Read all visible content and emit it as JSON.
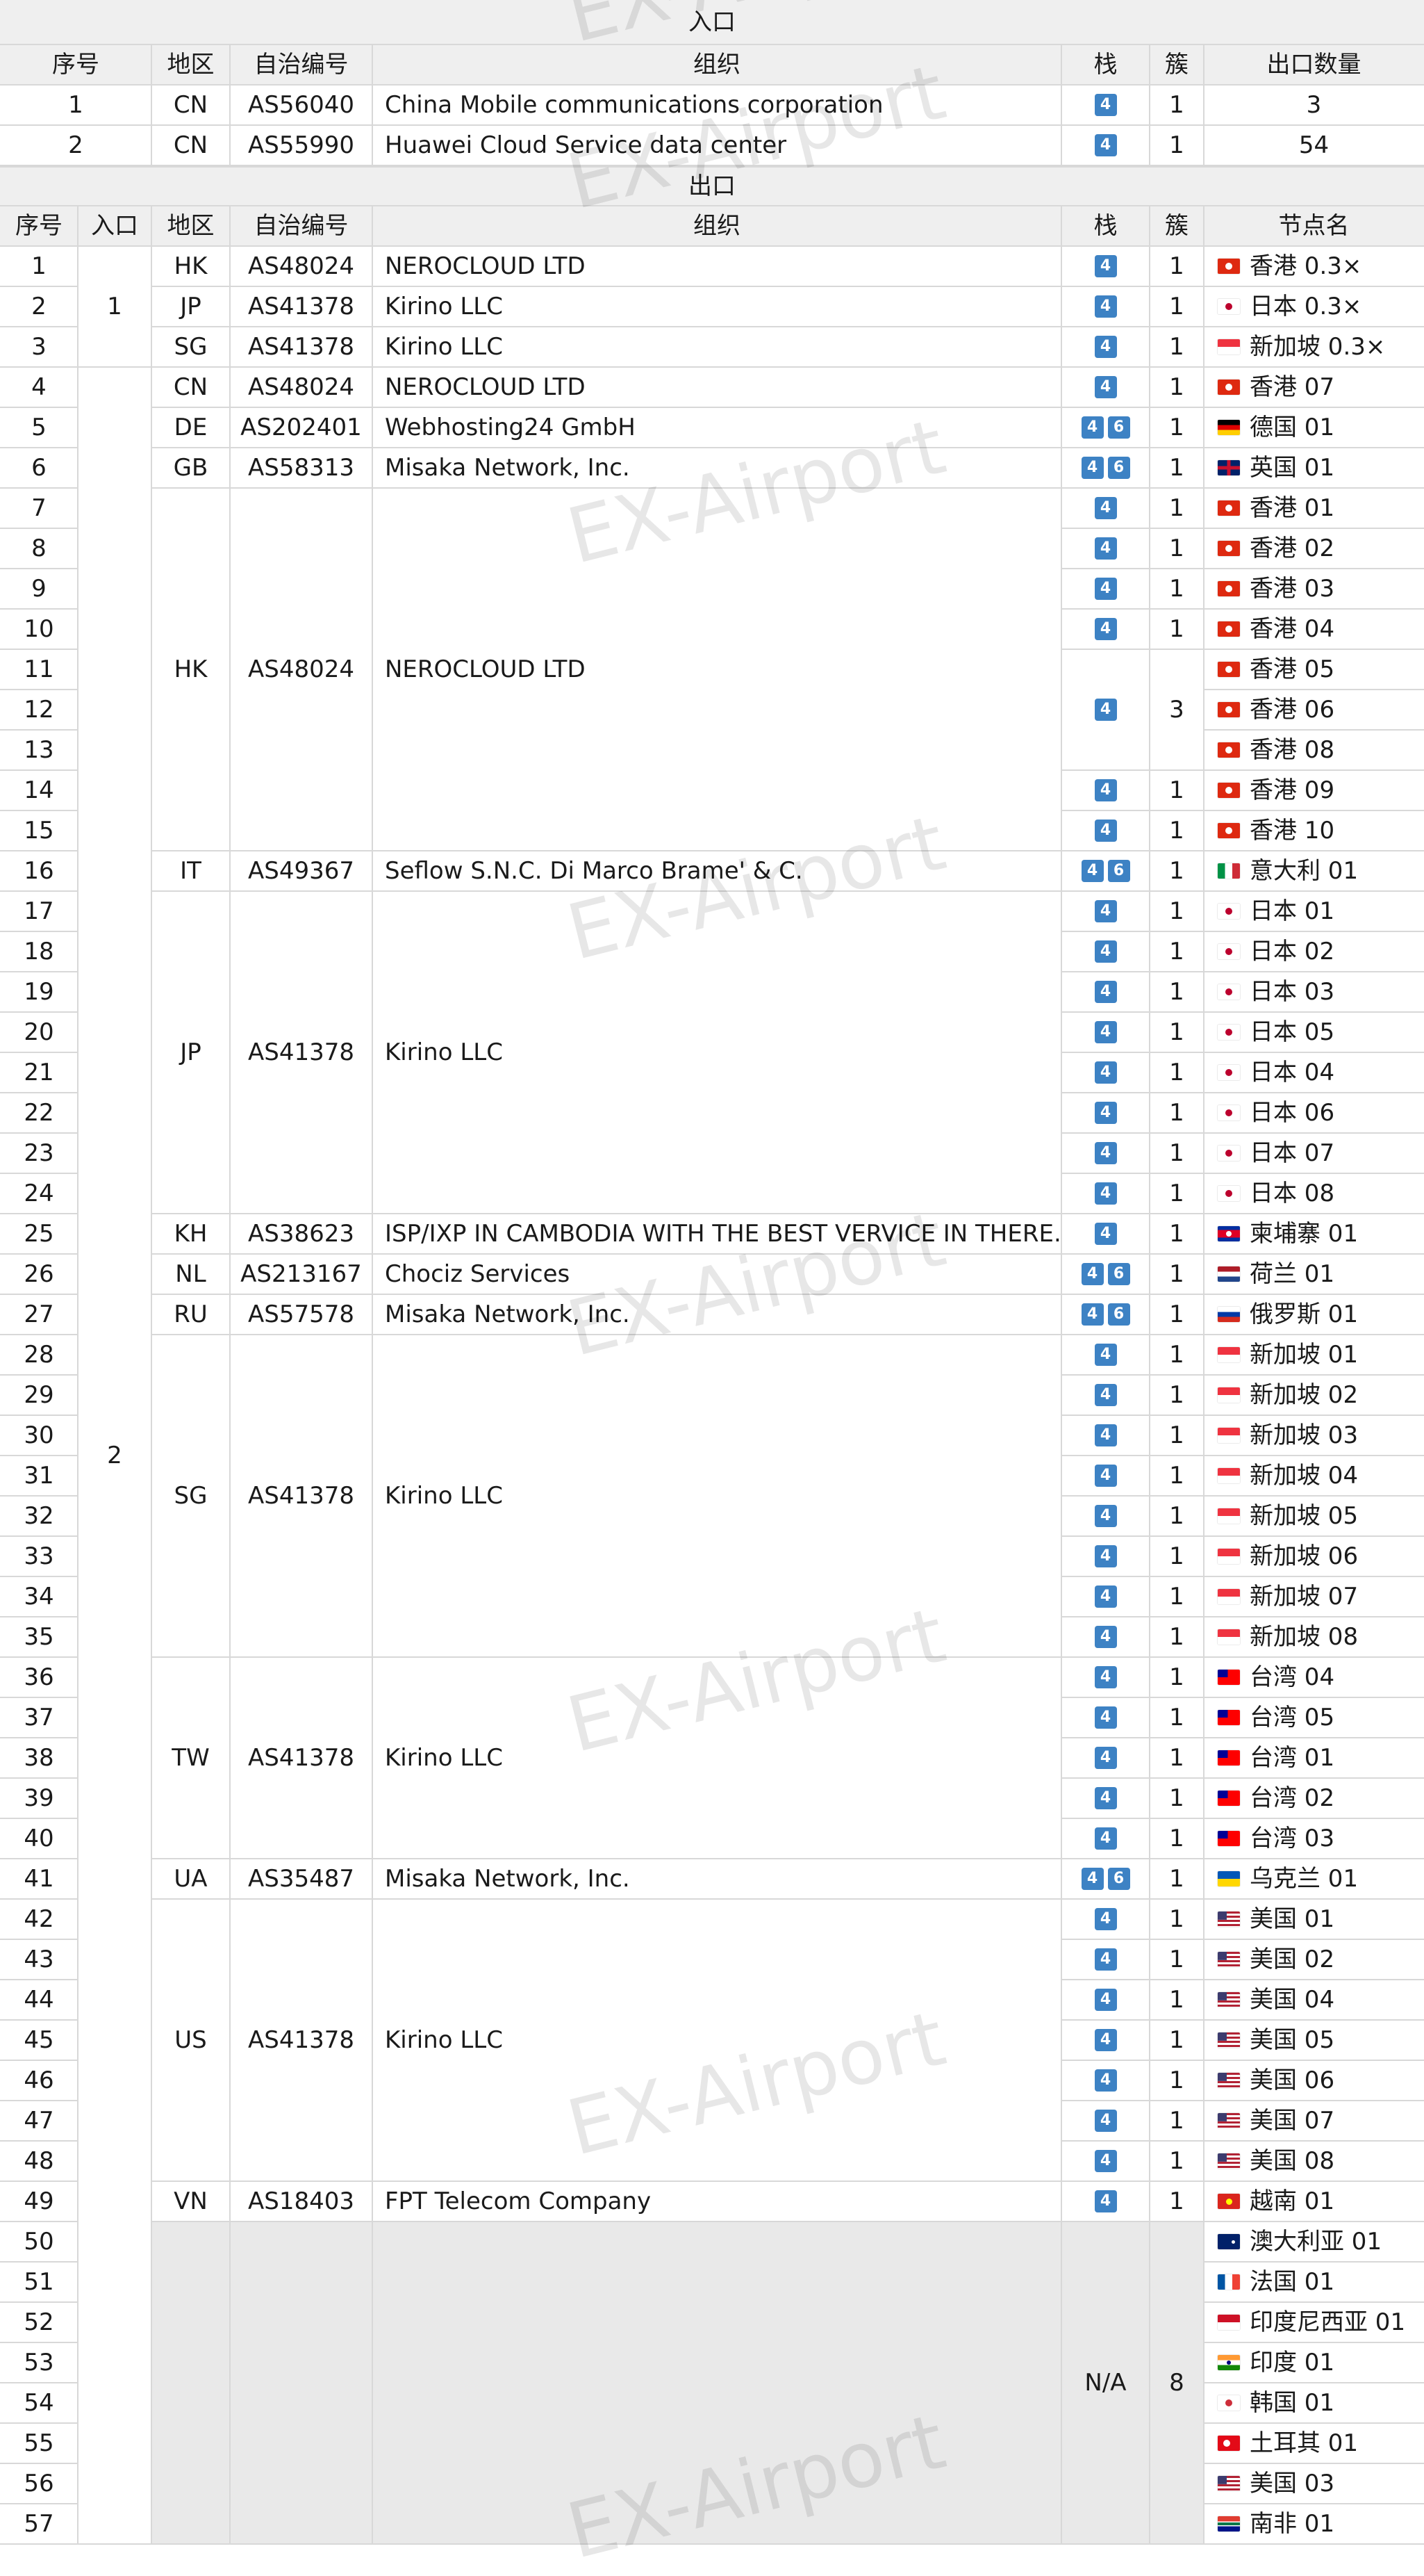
{
  "watermark": "EX-Airport",
  "colors": {
    "header_bg": "#efefef",
    "stack_badge": "#3d82c4",
    "grid": "#d8d8d8",
    "na_bg": "#e9e9e9"
  },
  "inbound": {
    "title": "入口",
    "headers": [
      "序号",
      "地区",
      "自治编号",
      "组织",
      "栈",
      "簇",
      "出口数量"
    ],
    "rows": [
      {
        "no": "1",
        "region": "CN",
        "asn": "AS56040",
        "org": "China Mobile communications corporation",
        "stack": [
          "4"
        ],
        "cluster": "1",
        "count": "3"
      },
      {
        "no": "2",
        "region": "CN",
        "asn": "AS55990",
        "org": "Huawei Cloud Service data center",
        "stack": [
          "4"
        ],
        "cluster": "1",
        "count": "54"
      }
    ]
  },
  "outbound": {
    "title": "出口",
    "headers": [
      "序号",
      "入口",
      "地区",
      "自治编号",
      "组织",
      "栈",
      "簇",
      "节点名"
    ],
    "entries": [
      {
        "label": "1",
        "from": 1,
        "to": 3
      },
      {
        "label": "2",
        "from": 4,
        "to": 57
      }
    ],
    "groups": [
      {
        "from": 1,
        "to": 1,
        "region": "HK",
        "asn": "AS48024",
        "org": "NEROCLOUD LTD"
      },
      {
        "from": 2,
        "to": 2,
        "region": "JP",
        "asn": "AS41378",
        "org": "Kirino LLC"
      },
      {
        "from": 3,
        "to": 3,
        "region": "SG",
        "asn": "AS41378",
        "org": "Kirino LLC"
      },
      {
        "from": 4,
        "to": 4,
        "region": "CN",
        "asn": "AS48024",
        "org": "NEROCLOUD LTD"
      },
      {
        "from": 5,
        "to": 5,
        "region": "DE",
        "asn": "AS202401",
        "org": "Webhosting24 GmbH"
      },
      {
        "from": 6,
        "to": 6,
        "region": "GB",
        "asn": "AS58313",
        "org": "Misaka Network, Inc."
      },
      {
        "from": 7,
        "to": 15,
        "region": "HK",
        "asn": "AS48024",
        "org": "NEROCLOUD LTD"
      },
      {
        "from": 16,
        "to": 16,
        "region": "IT",
        "asn": "AS49367",
        "org": "Seflow S.N.C. Di Marco Brame' & C."
      },
      {
        "from": 17,
        "to": 24,
        "region": "JP",
        "asn": "AS41378",
        "org": "Kirino LLC"
      },
      {
        "from": 25,
        "to": 25,
        "region": "KH",
        "asn": "AS38623",
        "org": "ISP/IXP IN CAMBODIA WITH THE BEST VERVICE IN THERE."
      },
      {
        "from": 26,
        "to": 26,
        "region": "NL",
        "asn": "AS213167",
        "org": "Chociz Services"
      },
      {
        "from": 27,
        "to": 27,
        "region": "RU",
        "asn": "AS57578",
        "org": "Misaka Network, Inc."
      },
      {
        "from": 28,
        "to": 35,
        "region": "SG",
        "asn": "AS41378",
        "org": "Kirino LLC"
      },
      {
        "from": 36,
        "to": 40,
        "region": "TW",
        "asn": "AS41378",
        "org": "Kirino LLC"
      },
      {
        "from": 41,
        "to": 41,
        "region": "UA",
        "asn": "AS35487",
        "org": "Misaka Network, Inc."
      },
      {
        "from": 42,
        "to": 48,
        "region": "US",
        "asn": "AS41378",
        "org": "Kirino LLC"
      },
      {
        "from": 49,
        "to": 49,
        "region": "VN",
        "asn": "AS18403",
        "org": "FPT Telecom Company"
      },
      {
        "from": 50,
        "to": 57,
        "region": "",
        "asn": "",
        "org": "",
        "na": true
      }
    ],
    "stackGroups": [
      {
        "from": 1,
        "to": 10,
        "stack": [
          "4"
        ],
        "perRow": true
      },
      {
        "from": 11,
        "to": 13,
        "stack": [
          "4"
        ],
        "cluster": "3"
      },
      {
        "from": 14,
        "to": 49,
        "stack": [
          "4"
        ],
        "perRow": true
      },
      {
        "from": 50,
        "to": 57,
        "stack": [
          "N/A"
        ],
        "cluster": "8"
      }
    ],
    "dualStackRows": [
      5,
      6,
      16,
      26,
      27,
      41
    ],
    "nodes": [
      {
        "no": "1",
        "flag": "hk",
        "name": "香港 0.3×"
      },
      {
        "no": "2",
        "flag": "jp",
        "name": "日本 0.3×"
      },
      {
        "no": "3",
        "flag": "sg",
        "name": "新加坡 0.3×"
      },
      {
        "no": "4",
        "flag": "hk",
        "name": "香港 07"
      },
      {
        "no": "5",
        "flag": "de",
        "name": "德国 01"
      },
      {
        "no": "6",
        "flag": "gb",
        "name": "英国 01"
      },
      {
        "no": "7",
        "flag": "hk",
        "name": "香港 01"
      },
      {
        "no": "8",
        "flag": "hk",
        "name": "香港 02"
      },
      {
        "no": "9",
        "flag": "hk",
        "name": "香港 03"
      },
      {
        "no": "10",
        "flag": "hk",
        "name": "香港 04"
      },
      {
        "no": "11",
        "flag": "hk",
        "name": "香港 05"
      },
      {
        "no": "12",
        "flag": "hk",
        "name": "香港 06"
      },
      {
        "no": "13",
        "flag": "hk",
        "name": "香港 08"
      },
      {
        "no": "14",
        "flag": "hk",
        "name": "香港 09"
      },
      {
        "no": "15",
        "flag": "hk",
        "name": "香港 10"
      },
      {
        "no": "16",
        "flag": "it",
        "name": "意大利 01"
      },
      {
        "no": "17",
        "flag": "jp",
        "name": "日本 01"
      },
      {
        "no": "18",
        "flag": "jp",
        "name": "日本 02"
      },
      {
        "no": "19",
        "flag": "jp",
        "name": "日本 03"
      },
      {
        "no": "20",
        "flag": "jp",
        "name": "日本 05"
      },
      {
        "no": "21",
        "flag": "jp",
        "name": "日本 04"
      },
      {
        "no": "22",
        "flag": "jp",
        "name": "日本 06"
      },
      {
        "no": "23",
        "flag": "jp",
        "name": "日本 07"
      },
      {
        "no": "24",
        "flag": "jp",
        "name": "日本 08"
      },
      {
        "no": "25",
        "flag": "kh",
        "name": "柬埔寨 01"
      },
      {
        "no": "26",
        "flag": "nl",
        "name": "荷兰 01"
      },
      {
        "no": "27",
        "flag": "ru",
        "name": "俄罗斯 01"
      },
      {
        "no": "28",
        "flag": "sg",
        "name": "新加坡 01"
      },
      {
        "no": "29",
        "flag": "sg",
        "name": "新加坡 02"
      },
      {
        "no": "30",
        "flag": "sg",
        "name": "新加坡 03"
      },
      {
        "no": "31",
        "flag": "sg",
        "name": "新加坡 04"
      },
      {
        "no": "32",
        "flag": "sg",
        "name": "新加坡 05"
      },
      {
        "no": "33",
        "flag": "sg",
        "name": "新加坡 06"
      },
      {
        "no": "34",
        "flag": "sg",
        "name": "新加坡 07"
      },
      {
        "no": "35",
        "flag": "sg",
        "name": "新加坡 08"
      },
      {
        "no": "36",
        "flag": "tw",
        "name": "台湾 04"
      },
      {
        "no": "37",
        "flag": "tw",
        "name": "台湾 05"
      },
      {
        "no": "38",
        "flag": "tw",
        "name": "台湾 01"
      },
      {
        "no": "39",
        "flag": "tw",
        "name": "台湾 02"
      },
      {
        "no": "40",
        "flag": "tw",
        "name": "台湾 03"
      },
      {
        "no": "41",
        "flag": "ua",
        "name": "乌克兰 01"
      },
      {
        "no": "42",
        "flag": "us",
        "name": "美国 01"
      },
      {
        "no": "43",
        "flag": "us",
        "name": "美国 02"
      },
      {
        "no": "44",
        "flag": "us",
        "name": "美国 04"
      },
      {
        "no": "45",
        "flag": "us",
        "name": "美国 05"
      },
      {
        "no": "46",
        "flag": "us",
        "name": "美国 06"
      },
      {
        "no": "47",
        "flag": "us",
        "name": "美国 07"
      },
      {
        "no": "48",
        "flag": "us",
        "name": "美国 08"
      },
      {
        "no": "49",
        "flag": "vn",
        "name": "越南 01"
      },
      {
        "no": "50",
        "flag": "au",
        "name": "澳大利亚 01"
      },
      {
        "no": "51",
        "flag": "fr",
        "name": "法国 01"
      },
      {
        "no": "52",
        "flag": "id",
        "name": "印度尼西亚 01"
      },
      {
        "no": "53",
        "flag": "in",
        "name": "印度 01"
      },
      {
        "no": "54",
        "flag": "kr",
        "name": "韩国 01"
      },
      {
        "no": "55",
        "flag": "tr",
        "name": "土耳其 01"
      },
      {
        "no": "56",
        "flag": "us",
        "name": "美国 03"
      },
      {
        "no": "57",
        "flag": "za",
        "name": "南非 01"
      }
    ]
  }
}
